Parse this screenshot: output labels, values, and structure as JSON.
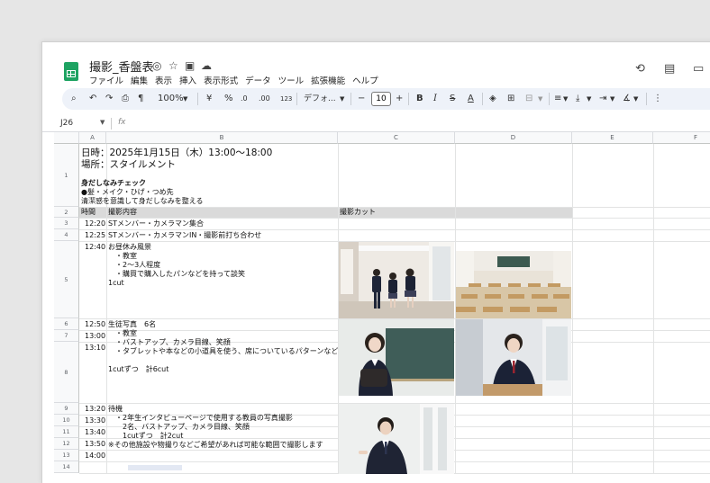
{
  "doc": {
    "title": "撮影_香盤表",
    "menu": [
      "ファイル",
      "編集",
      "表示",
      "挿入",
      "表示形式",
      "データ",
      "ツール",
      "拡張機能",
      "ヘルプ"
    ]
  },
  "toolbar": {
    "zoom": "100%",
    "currency": "¥",
    "percent": "%",
    "decrease_decimal": ".0",
    "increase_decimal": ".00",
    "number_format": "123",
    "font": "デフォ...",
    "font_size": "10",
    "minus": "−",
    "plus": "+",
    "bold": "B",
    "italic": "I",
    "strike": "S",
    "text_color": "A"
  },
  "formula_bar": {
    "name_box": "J26",
    "fx": "fx"
  },
  "columns": [
    "A",
    "B",
    "C",
    "D",
    "E",
    "F"
  ],
  "rows": [
    "1",
    "2",
    "3",
    "4",
    "5",
    "6",
    "7",
    "8",
    "9",
    "10",
    "11",
    "12",
    "13",
    "14"
  ],
  "sheet": {
    "r1_date": "日時：2025年1月15日（木）13:00〜18:00",
    "r1_place": "場所：スタイルメント",
    "r1_check_title": "身だしなみチェック",
    "r1_check_items": "●髪・メイク・ひげ・つめ先",
    "r1_check_note": "清潔感を意識して身だしなみを整える",
    "h_time": "時間",
    "h_content": "撮影内容",
    "h_cut": "撮影カット",
    "r3_time": "12:20",
    "r3_content": "STメンバー・カメラマン集合",
    "r4_time": "12:25",
    "r4_content": "STメンバー・カメラマンIN・撮影前打ち合わせ",
    "r5_time": "12:40",
    "r5_content": "お昼休み風景\n　・教室\n　・2〜3人程度\n　・購買で購入したパンなどを持って談笑\n1cut",
    "r6_time": "12:50",
    "r6_content": "生徒写真　6名\n　・教室\n　・バストアップ、カメラ目線、笑顔\n　・タブレットや本などの小道具を使う、席についているパターンなど\n\n1cutずつ　計6cut",
    "r7_time": "13:00",
    "r8_time": "13:10",
    "r9_time": "13:20",
    "r9_content": "待機\n　・2年生インタビューページで使用する教員の写真撮影\n　　2名、バストアップ、カメラ目線、笑顔\n　　1cutずつ　計2cut\n※その他施設や物撮りなどご希望があれば可能な範囲で撮影します",
    "r10_time": "13:30",
    "r11_time": "13:40",
    "r12_time": "13:50",
    "r13_time": "14:00"
  },
  "colors": {
    "sheets_green": "#1ea362",
    "header_gray": "#dadada",
    "toolbar_bg": "#eef2f9"
  }
}
